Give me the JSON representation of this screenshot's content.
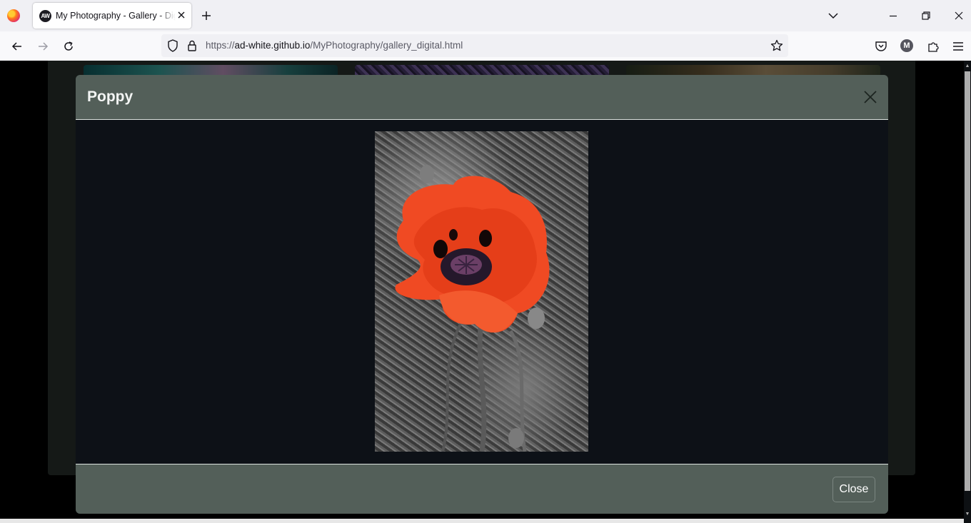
{
  "browser": {
    "tab_title": "My Photography - Gallery - Digital",
    "tab_favicon_text": "AW",
    "url_scheme": "https://",
    "url_domain": "ad-white.github.io",
    "url_path": "/MyPhotography/gallery_digital.html",
    "account_initial": "M"
  },
  "modal": {
    "title": "Poppy",
    "close_label": "Close",
    "image_alt": "Red poppy flower on a black and white background"
  },
  "colors": {
    "modal_header_bg": "#535f59",
    "modal_body_bg": "#0d1117",
    "poppy_red": "#f04a23"
  },
  "icons": {
    "back": "back-arrow-icon",
    "forward": "forward-arrow-icon",
    "reload": "reload-icon",
    "shield": "tracking-shield-icon",
    "lock": "lock-icon",
    "bookmark": "star-icon",
    "pocket": "pocket-icon",
    "extensions": "puzzle-icon",
    "menu": "hamburger-menu-icon"
  }
}
